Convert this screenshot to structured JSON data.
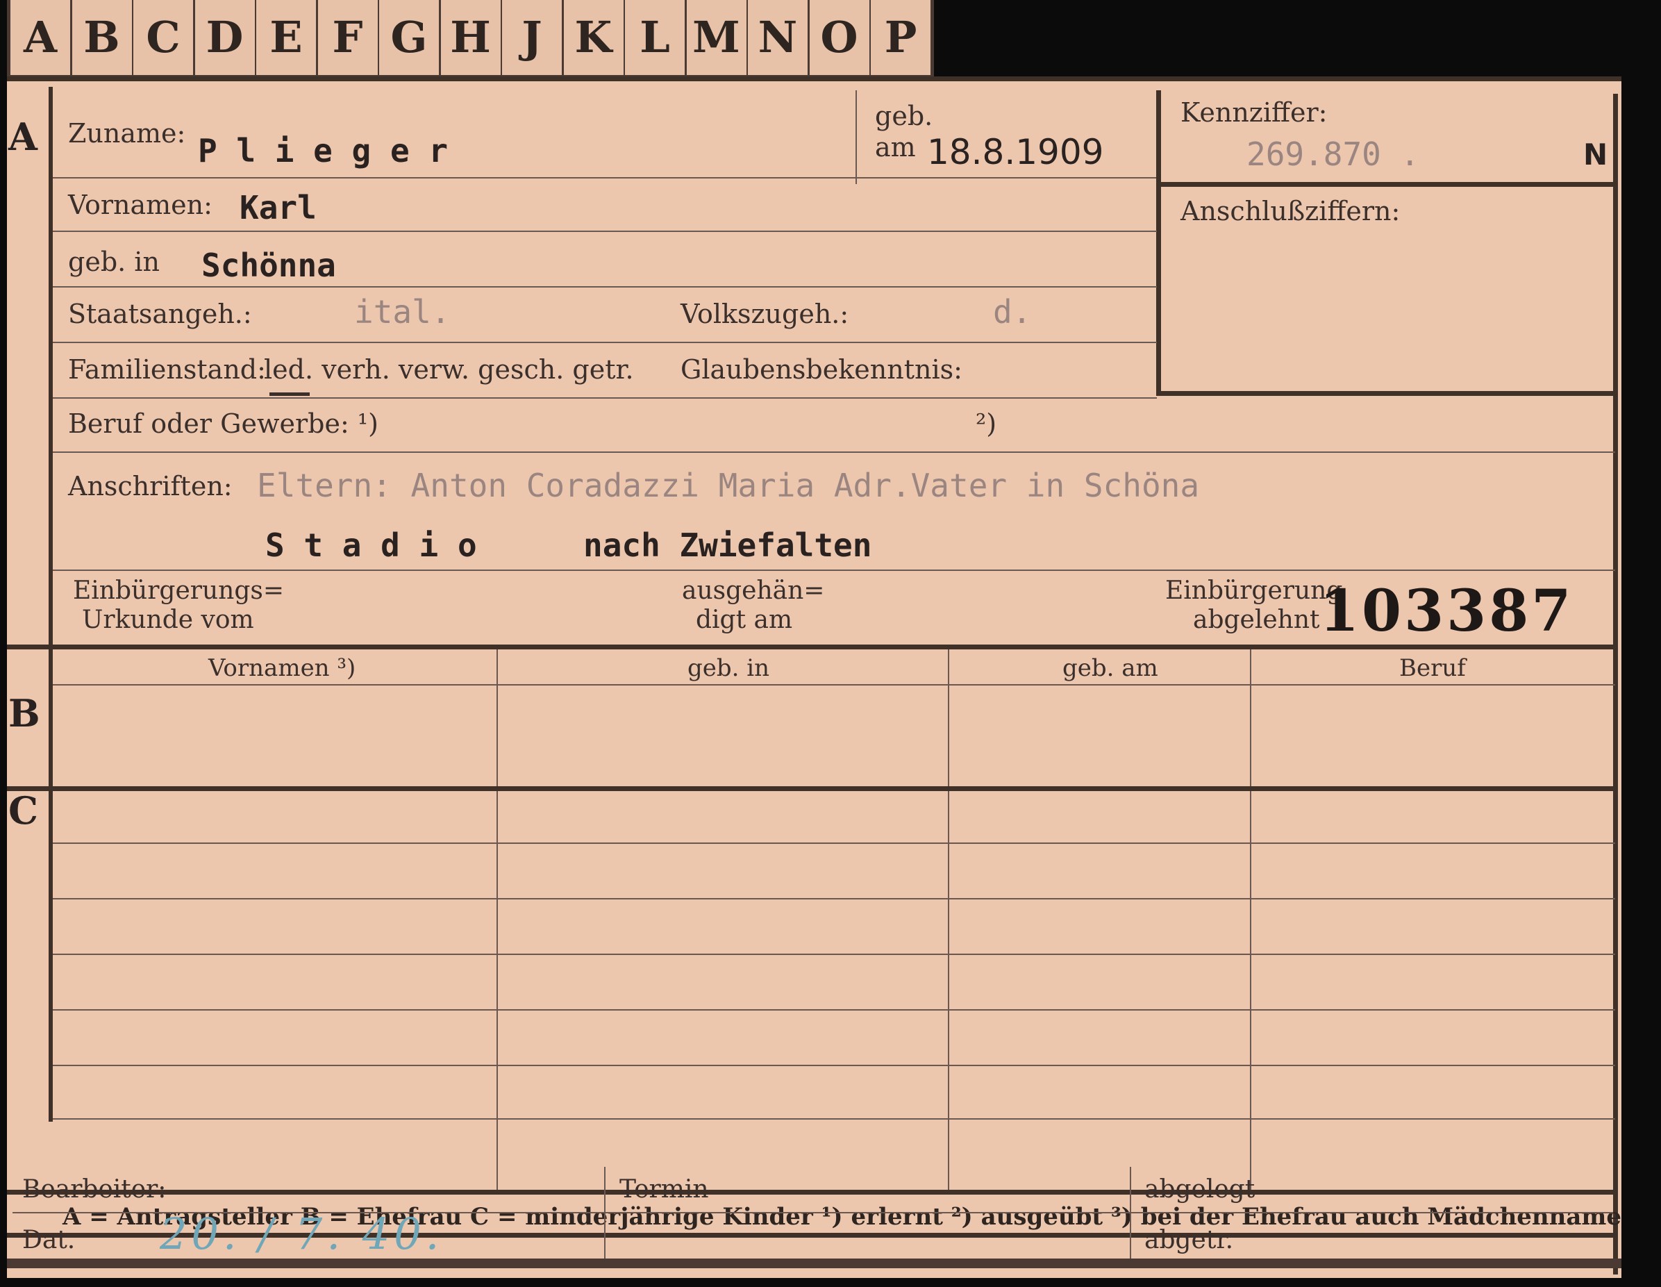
{
  "tabs": [
    "A",
    "B",
    "C",
    "D",
    "E",
    "F",
    "G",
    "H",
    "J",
    "K",
    "L",
    "M",
    "N",
    "O",
    "P"
  ],
  "sections": {
    "a": "A",
    "b": "B",
    "c": "C"
  },
  "fields": {
    "zuname_label": "Zuname:",
    "zuname_value": "P l i e g e r",
    "geb_am_label_1": "geb.",
    "geb_am_label_2": "am",
    "geb_am_value": "18.8.1909",
    "kennziffer_label": "Kennziffer:",
    "kennziffer_value": "269.870 .",
    "kennziffer_suffix": "N",
    "anschluss_label": "Anschlußziffern:",
    "vornamen_label": "Vornamen:",
    "vornamen_value": "Karl",
    "geb_in_label": "geb. in",
    "geb_in_value": "Schönna",
    "staatsangeh_label": "Staatsangeh.:",
    "staatsangeh_value": "ital.",
    "volkszugeh_label": "Volkszugeh.:",
    "volkszugeh_value": "d.",
    "familienstand_label": "Familienstand:",
    "familienstand_options": "led. verh. verw. gesch. getr.",
    "glaubens_label": "Glaubensbekenntnis:",
    "beruf_label": "Beruf oder Gewerbe: ¹)",
    "beruf_note2": "²)",
    "anschriften_label": "Anschriften:",
    "anschriften_line1": "Eltern: Anton Coradazzi Maria  Adr.Vater in  Schöna",
    "anschriften_line2_a": "S t a d i o",
    "anschriften_line2_b": "nach Zwiefalten",
    "einbuergerung_label_1": "Einbürgerungs=",
    "einbuergerung_label_2": "Urkunde vom",
    "ausgehaen_label_1": "ausgehän=",
    "ausgehaen_label_2": "digt am",
    "abgelehnt_label_1": "Einbürgerung",
    "abgelehnt_label_2": "abgelehnt",
    "stamp_number": "103387"
  },
  "table": {
    "headers": [
      "Vornamen ³)",
      "geb. in",
      "geb. am",
      "Beruf"
    ]
  },
  "legend": "A = Antragsteller   B = Ehefrau   C = minderjährige Kinder   ¹) erlernt   ²) ausgeübt   ³) bei der Ehefrau auch Mädchenname",
  "footer": {
    "bearbeiter_label": "Bearbeiter:",
    "dat_label": "Dat.",
    "dat_value": "20. / 7. 40.",
    "termin_label": "Termin",
    "abgelegt_label": "abgelegt",
    "abgetr_label": "abgetr."
  },
  "colors": {
    "card": "#edc7ad",
    "ink": "#3b2f2c",
    "pencil": "#6fa6b8",
    "background": "#0b0b0b"
  }
}
